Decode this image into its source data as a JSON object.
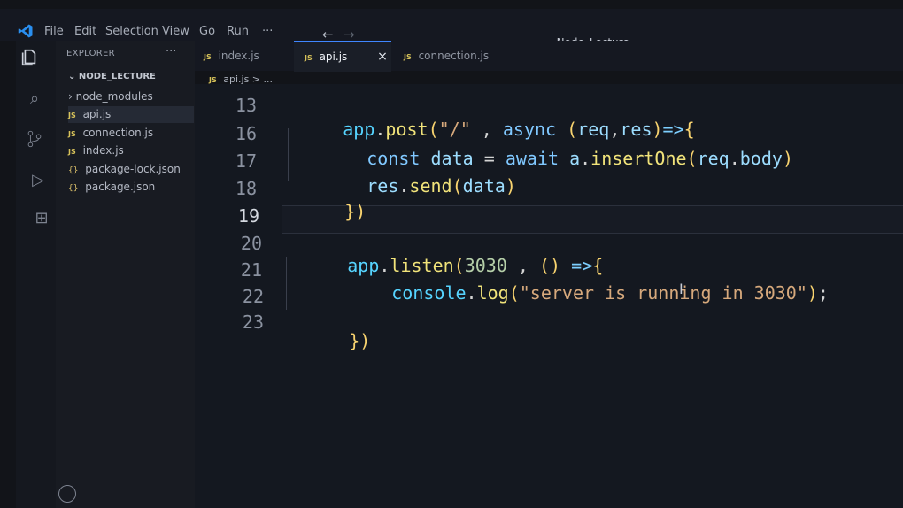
{
  "menu": {
    "items": [
      "File",
      "Edit",
      "Selection",
      "View",
      "Go",
      "Run",
      "···"
    ]
  },
  "title": {
    "back": "←",
    "forward": "→",
    "search": "Node_Lecture"
  },
  "sidebar": {
    "explorer_title": "EXPLORER",
    "more": "···",
    "folder": "NODE_LECTURE",
    "items": [
      {
        "label": "node_modules"
      },
      {
        "label": "api.js"
      },
      {
        "label": "connection.js"
      },
      {
        "label": "index.js"
      },
      {
        "label": "package-lock.json"
      },
      {
        "label": "package.json"
      }
    ]
  },
  "tabs": [
    {
      "label": "index.js"
    },
    {
      "label": "api.js"
    },
    {
      "label": "connection.js"
    }
  ],
  "breadcrumb": "api.js > ...",
  "editor": {
    "lines": [
      {
        "number": "13",
        "text": "app.post(\"/\" , async (req,res)=>{"
      },
      {
        "number": "16",
        "text": "const data = await a.insertOne(req.body)"
      },
      {
        "number": "17",
        "text": "res.send(data)"
      },
      {
        "number": "18",
        "text": "})"
      },
      {
        "number": "19",
        "text": ""
      },
      {
        "number": "20",
        "text": "app.listen(3030 , () =>{"
      },
      {
        "number": "21",
        "text": "console.log(\"server is running in 3030\");"
      },
      {
        "number": "22",
        "text": ""
      },
      {
        "number": "23",
        "text": "})"
      }
    ]
  },
  "icons": {
    "logo": "vscode-logo-icon",
    "files": "files-icon",
    "search": "search-icon",
    "source_control": "source-control-icon",
    "run_debug": "run-debug-icon",
    "extensions": "extensions-icon",
    "account": "account-icon",
    "copilot": "copilot-icon",
    "cursor": "text-cursor-icon"
  },
  "colors": {
    "keyword": "#80c8ff",
    "function": "#f1e37a",
    "string": "#d7a97c",
    "number": "#b5cea8",
    "brackets": "#f8d36f",
    "variable": "#9cdcfe",
    "accent": "#3f86ff"
  }
}
